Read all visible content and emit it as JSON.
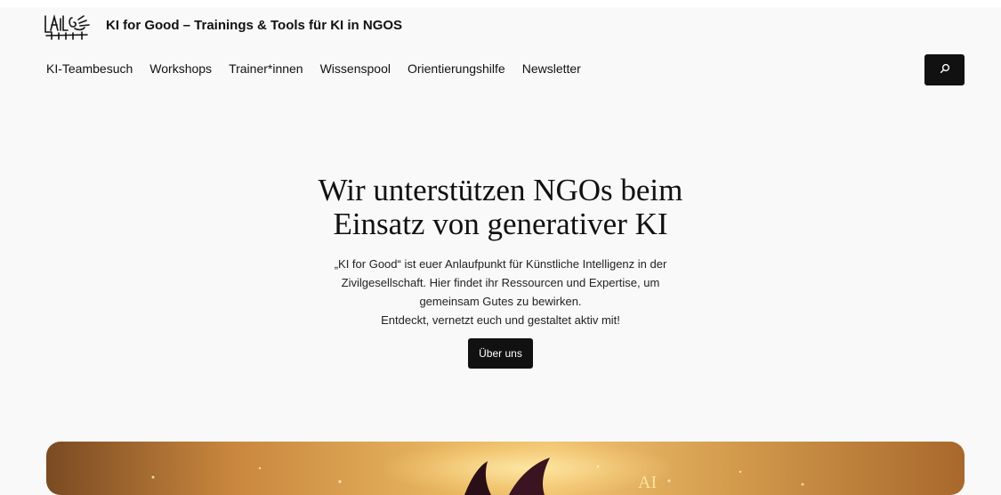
{
  "site": {
    "title": "KI for Good – Trainings & Tools für KI in NGOS",
    "logo_icon": "ai-logo-icon"
  },
  "nav": {
    "items": [
      "KI-Teambesuch",
      "Workshops",
      "Trainer*innen",
      "Wissenspool",
      "Orientierungshilfe",
      "Newsletter"
    ],
    "search_icon": "search-icon"
  },
  "hero": {
    "title_line1": "Wir unterstützen NGOs beim",
    "title_line2": "Einsatz von generativer KI",
    "text_lines": [
      "„KI for Good“ ist euer Anlaufpunkt für Künstliche Intelligenz in der",
      "Zivilgesellschaft. Hier findet ihr Ressourcen und Expertise, um",
      "gemeinsam Gutes zu bewirken.",
      "Entdeckt, vernetzt euch und gestaltet aktiv mit!"
    ],
    "cta_label": "Über uns"
  },
  "colors": {
    "background": "#f9f9f9",
    "button": "#111111",
    "button_text": "#ffffff"
  }
}
